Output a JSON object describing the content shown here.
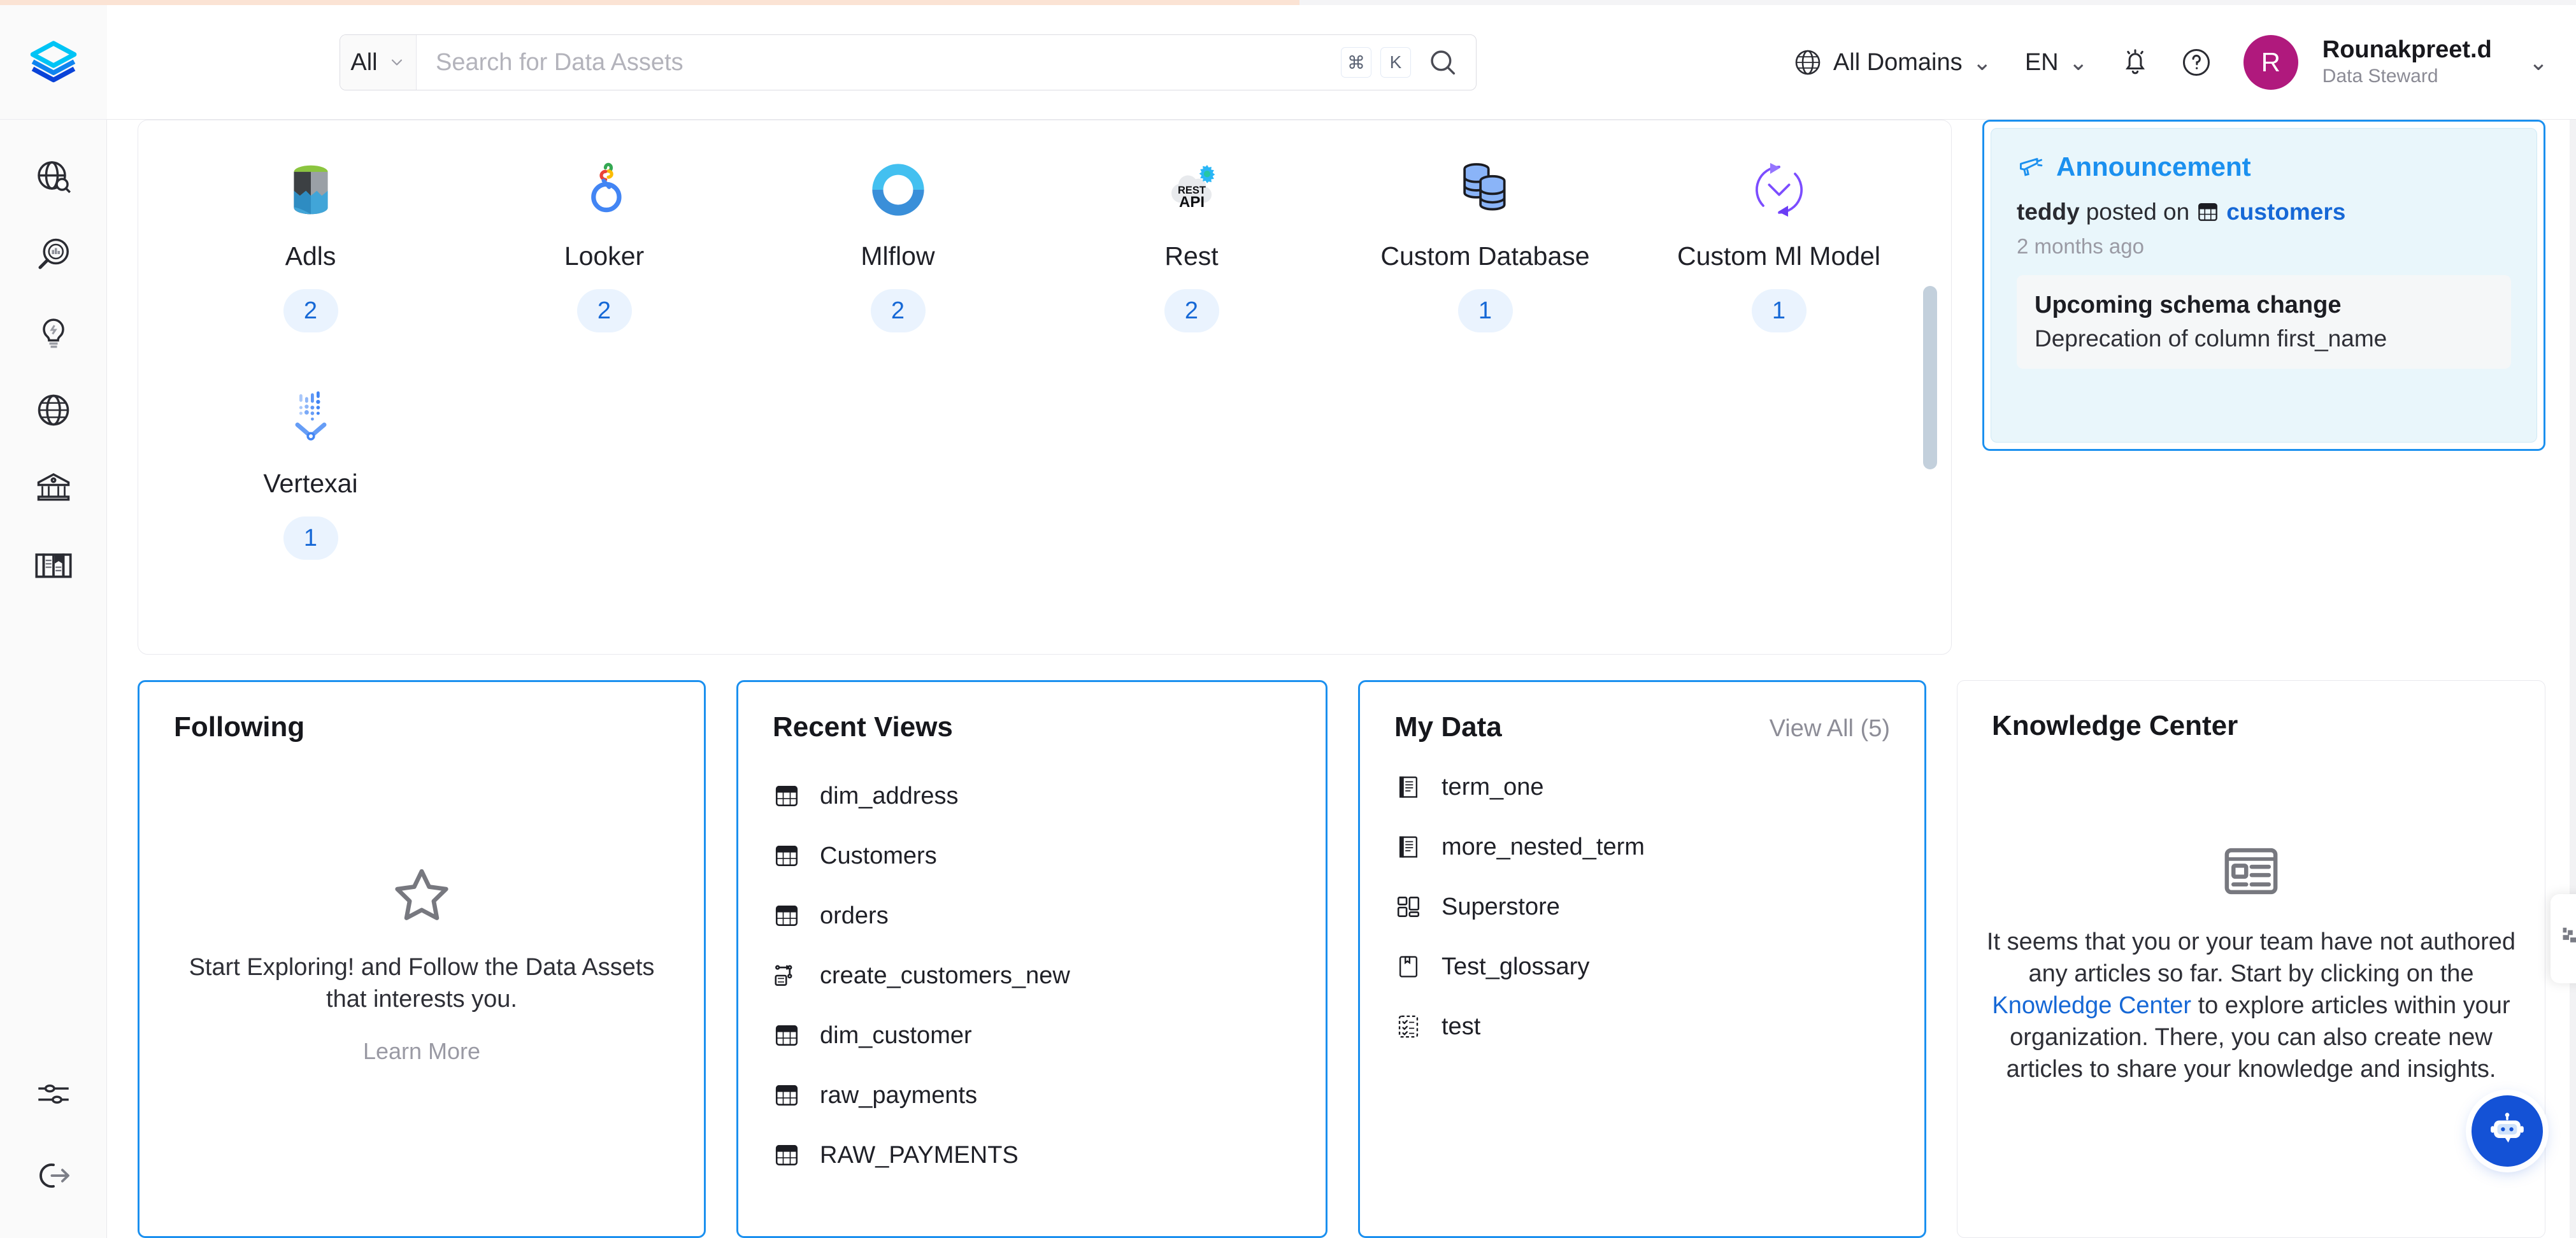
{
  "brand": {
    "logo_name": "openmetadata-logo",
    "accent": "#1b90ef",
    "avatar_color": "#b0197d"
  },
  "header": {
    "search": {
      "scope_label": "All",
      "placeholder": "Search for Data Assets",
      "value": "",
      "key_cmd": "⌘",
      "key_k": "K"
    },
    "domains_label": "All Domains",
    "language_label": "EN",
    "user": {
      "initial": "R",
      "name": "Rounakpreet.d",
      "role": "Data Steward"
    }
  },
  "sidebar": {
    "items": [
      {
        "name": "explore",
        "icon": "globe-search-icon"
      },
      {
        "name": "observability",
        "icon": "magnifier-chart-icon"
      },
      {
        "name": "insights",
        "icon": "lightbulb-icon"
      },
      {
        "name": "domains",
        "icon": "globe-icon"
      },
      {
        "name": "govern",
        "icon": "bank-icon"
      },
      {
        "name": "knowledge-center",
        "icon": "open-book-icon"
      }
    ],
    "bottom_items": [
      {
        "name": "settings",
        "icon": "sliders-icon"
      },
      {
        "name": "logout",
        "icon": "logout-arrow-icon"
      }
    ]
  },
  "services": [
    {
      "label": "Adls",
      "count": "2",
      "icon": "adls-icon"
    },
    {
      "label": "Looker",
      "count": "2",
      "icon": "looker-icon"
    },
    {
      "label": "Mlflow",
      "count": "2",
      "icon": "mlflow-icon"
    },
    {
      "label": "Rest",
      "count": "2",
      "icon": "rest-api-icon"
    },
    {
      "label": "Custom Database",
      "count": "1",
      "icon": "custom-database-icon"
    },
    {
      "label": "Custom Ml Model",
      "count": "1",
      "icon": "custom-ml-model-icon"
    },
    {
      "label": "Vertexai",
      "count": "1",
      "icon": "vertexai-icon"
    }
  ],
  "announcement": {
    "title": "Announcement",
    "icon": "megaphone-icon",
    "author": "teddy",
    "posted_on": "posted on",
    "entity": "customers",
    "entity_icon": "table-icon",
    "time": "2 months ago",
    "card_title": "Upcoming schema change",
    "card_body": "Deprecation of column first_name"
  },
  "following": {
    "title": "Following",
    "empty_icon": "star-outline-icon",
    "empty_text": "Start Exploring! and Follow the Data Assets that interests you.",
    "link": "Learn More"
  },
  "recent_views": {
    "title": "Recent Views",
    "items": [
      {
        "label": "dim_address",
        "icon": "table-icon"
      },
      {
        "label": "Customers",
        "icon": "table-icon"
      },
      {
        "label": "orders",
        "icon": "table-icon"
      },
      {
        "label": "create_customers_new",
        "icon": "pipeline-icon"
      },
      {
        "label": "dim_customer",
        "icon": "table-icon"
      },
      {
        "label": "raw_payments",
        "icon": "table-icon"
      },
      {
        "label": "RAW_PAYMENTS",
        "icon": "table-icon"
      }
    ]
  },
  "my_data": {
    "title": "My Data",
    "view_all": "View All (5)",
    "items": [
      {
        "label": "term_one",
        "icon": "glossary-term-icon"
      },
      {
        "label": "more_nested_term",
        "icon": "glossary-term-icon"
      },
      {
        "label": "Superstore",
        "icon": "dashboard-icon"
      },
      {
        "label": "Test_glossary",
        "icon": "glossary-icon"
      },
      {
        "label": "test",
        "icon": "checklist-icon"
      }
    ]
  },
  "knowledge_center": {
    "title": "Knowledge Center",
    "empty_icon": "article-icon",
    "text_before": "It seems that you or your team have not authored any articles so far. Start by clicking on the ",
    "link": "Knowledge Center",
    "text_after": " to explore articles within your organization. There, you can also create new articles to share your knowledge and insights."
  },
  "chat": {
    "icon": "chatbot-icon"
  }
}
